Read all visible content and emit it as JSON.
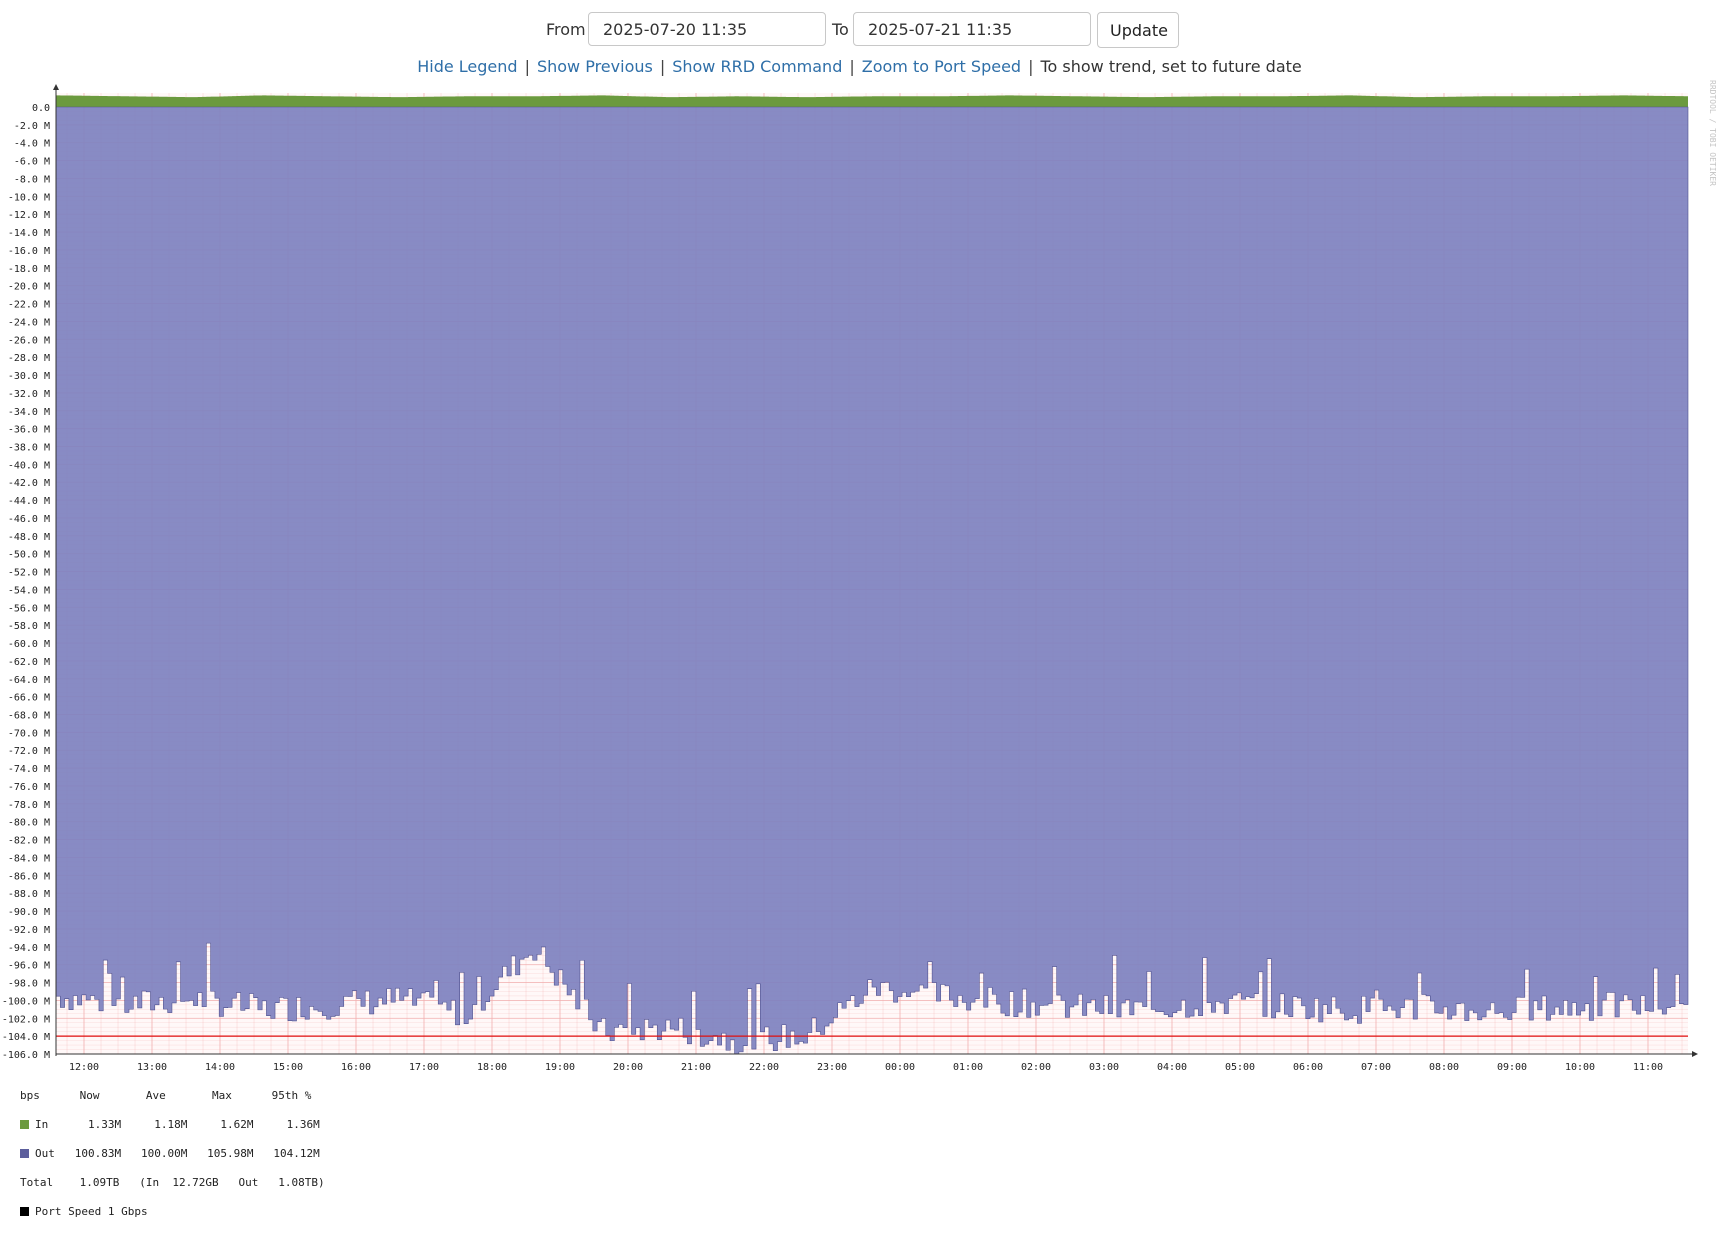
{
  "controls": {
    "from_label": "From",
    "from_value": "2025-07-20 11:35",
    "to_label": "To",
    "to_value": "2025-07-21 11:35",
    "update_label": "Update"
  },
  "links": {
    "hide_legend": "Hide Legend",
    "show_previous": "Show Previous",
    "show_rrd_command": "Show RRD Command",
    "zoom_port_speed": "Zoom to Port Speed",
    "trend_note": "To show trend, set to future date",
    "separator": "|"
  },
  "watermark": "RRDTOOL / TOBI OETIKER",
  "colors": {
    "in": "#6b9a3e",
    "out": "#7f82bf",
    "port_speed_line": "#e01010",
    "grid": "#f2b0b0"
  },
  "chart_data": {
    "type": "area",
    "ylabel": "",
    "ylim": [
      -106,
      0
    ],
    "yticks": [
      "0.0",
      "-2.0 M",
      "-4.0 M",
      "-6.0 M",
      "-8.0 M",
      "-10.0 M",
      "-12.0 M",
      "-14.0 M",
      "-16.0 M",
      "-18.0 M",
      "-20.0 M",
      "-22.0 M",
      "-24.0 M",
      "-26.0 M",
      "-28.0 M",
      "-30.0 M",
      "-32.0 M",
      "-34.0 M",
      "-36.0 M",
      "-38.0 M",
      "-40.0 M",
      "-42.0 M",
      "-44.0 M",
      "-46.0 M",
      "-48.0 M",
      "-50.0 M",
      "-52.0 M",
      "-54.0 M",
      "-56.0 M",
      "-58.0 M",
      "-60.0 M",
      "-62.0 M",
      "-64.0 M",
      "-66.0 M",
      "-68.0 M",
      "-70.0 M",
      "-72.0 M",
      "-74.0 M",
      "-76.0 M",
      "-78.0 M",
      "-80.0 M",
      "-82.0 M",
      "-84.0 M",
      "-86.0 M",
      "-88.0 M",
      "-90.0 M",
      "-92.0 M",
      "-94.0 M",
      "-96.0 M",
      "-98.0 M",
      "-100.0 M",
      "-102.0 M",
      "-104.0 M",
      "-106.0 M"
    ],
    "xticks": [
      "12:00",
      "13:00",
      "14:00",
      "15:00",
      "16:00",
      "17:00",
      "18:00",
      "19:00",
      "20:00",
      "21:00",
      "22:00",
      "23:00",
      "00:00",
      "01:00",
      "02:00",
      "03:00",
      "04:00",
      "05:00",
      "06:00",
      "07:00",
      "08:00",
      "09:00",
      "10:00",
      "11:00"
    ],
    "x_start": "2025-07-20 11:35",
    "x_end": "2025-07-21 11:35",
    "series": [
      {
        "name": "In",
        "values": [
          1.3,
          1.2,
          1.1,
          1.3,
          1.2,
          1.1,
          1.2,
          1.2,
          1.3,
          1.1,
          1.2,
          1.1,
          1.2,
          1.2,
          1.3,
          1.2,
          1.1,
          1.2,
          1.2,
          1.3,
          1.1,
          1.2,
          1.2,
          1.3,
          1.2
        ]
      },
      {
        "name": "Out",
        "values": [
          -99.5,
          -100.5,
          -99.8,
          -101,
          -100.5,
          -99.9,
          -101.5,
          -94,
          -103.5,
          -103,
          -104.5,
          -104,
          -98.5,
          -99.5,
          -100.2,
          -100.8,
          -101,
          -100.2,
          -100.6,
          -101,
          -100.8,
          -101.2,
          -100.9,
          -100.6,
          -100.8
        ]
      }
    ],
    "port_speed_line_value": -104.0,
    "grid": true
  },
  "legend": {
    "header": "bps      Now       Ave       Max      95th %",
    "in_row": "In      1.33M     1.18M     1.62M     1.36M",
    "out_row": "Out   100.83M   100.00M   105.98M   104.12M",
    "total_row": "Total    1.09TB   (In  12.72GB   Out   1.08TB)",
    "port_row": "Port Speed 1 Gbps"
  }
}
